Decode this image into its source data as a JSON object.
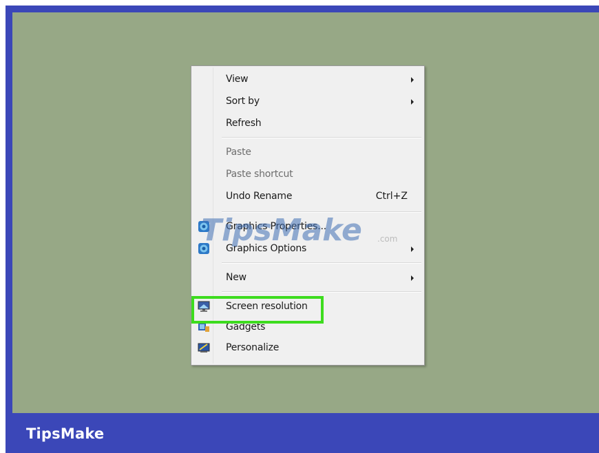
{
  "menu": {
    "items": [
      {
        "label": "View",
        "submenu": true
      },
      {
        "label": "Sort by",
        "submenu": true
      },
      {
        "label": "Refresh"
      },
      {
        "label": "Paste",
        "disabled": true
      },
      {
        "label": "Paste shortcut",
        "disabled": true
      },
      {
        "label": "Undo Rename",
        "shortcut": "Ctrl+Z"
      },
      {
        "label": "Graphics Properties...",
        "icon": "intel-graphics-icon"
      },
      {
        "label": "Graphics Options",
        "icon": "intel-graphics-icon",
        "submenu": true
      },
      {
        "label": "New",
        "submenu": true
      },
      {
        "label": "Screen resolution",
        "icon": "monitor-icon",
        "highlighted": true
      },
      {
        "label": "Gadgets",
        "icon": "gadgets-icon"
      },
      {
        "label": "Personalize",
        "icon": "personalize-icon"
      }
    ]
  },
  "watermark": {
    "text": "TipsMake",
    "suffix": ".com"
  },
  "footer": {
    "brand": "TipsMake"
  },
  "colors": {
    "frame": "#3b47b8",
    "desktop": "#97a886",
    "menu_bg": "#f0f0f0",
    "highlight": "#3ddc1e"
  }
}
